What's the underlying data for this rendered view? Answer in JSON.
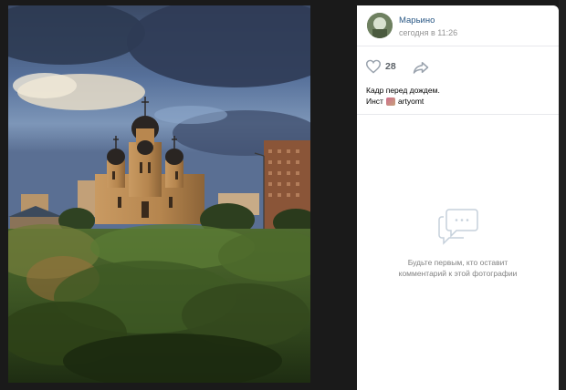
{
  "post": {
    "author": "Марьино",
    "date": "сегодня в 11:26",
    "likes": "28",
    "caption_line1": "Кадр перед дождем.",
    "caption_prefix": "Инст",
    "caption_handle": "artyomt"
  },
  "comments": {
    "empty_line1": "Будьте первым, кто оставит",
    "empty_line2": "комментарий к этой фотографии"
  },
  "colors": {
    "link": "#2a5885",
    "muted": "#939393",
    "divider": "#e7e8ec"
  },
  "icons": {
    "like": "heart-outline",
    "share": "share-arrow",
    "comments": "speech-bubble"
  }
}
